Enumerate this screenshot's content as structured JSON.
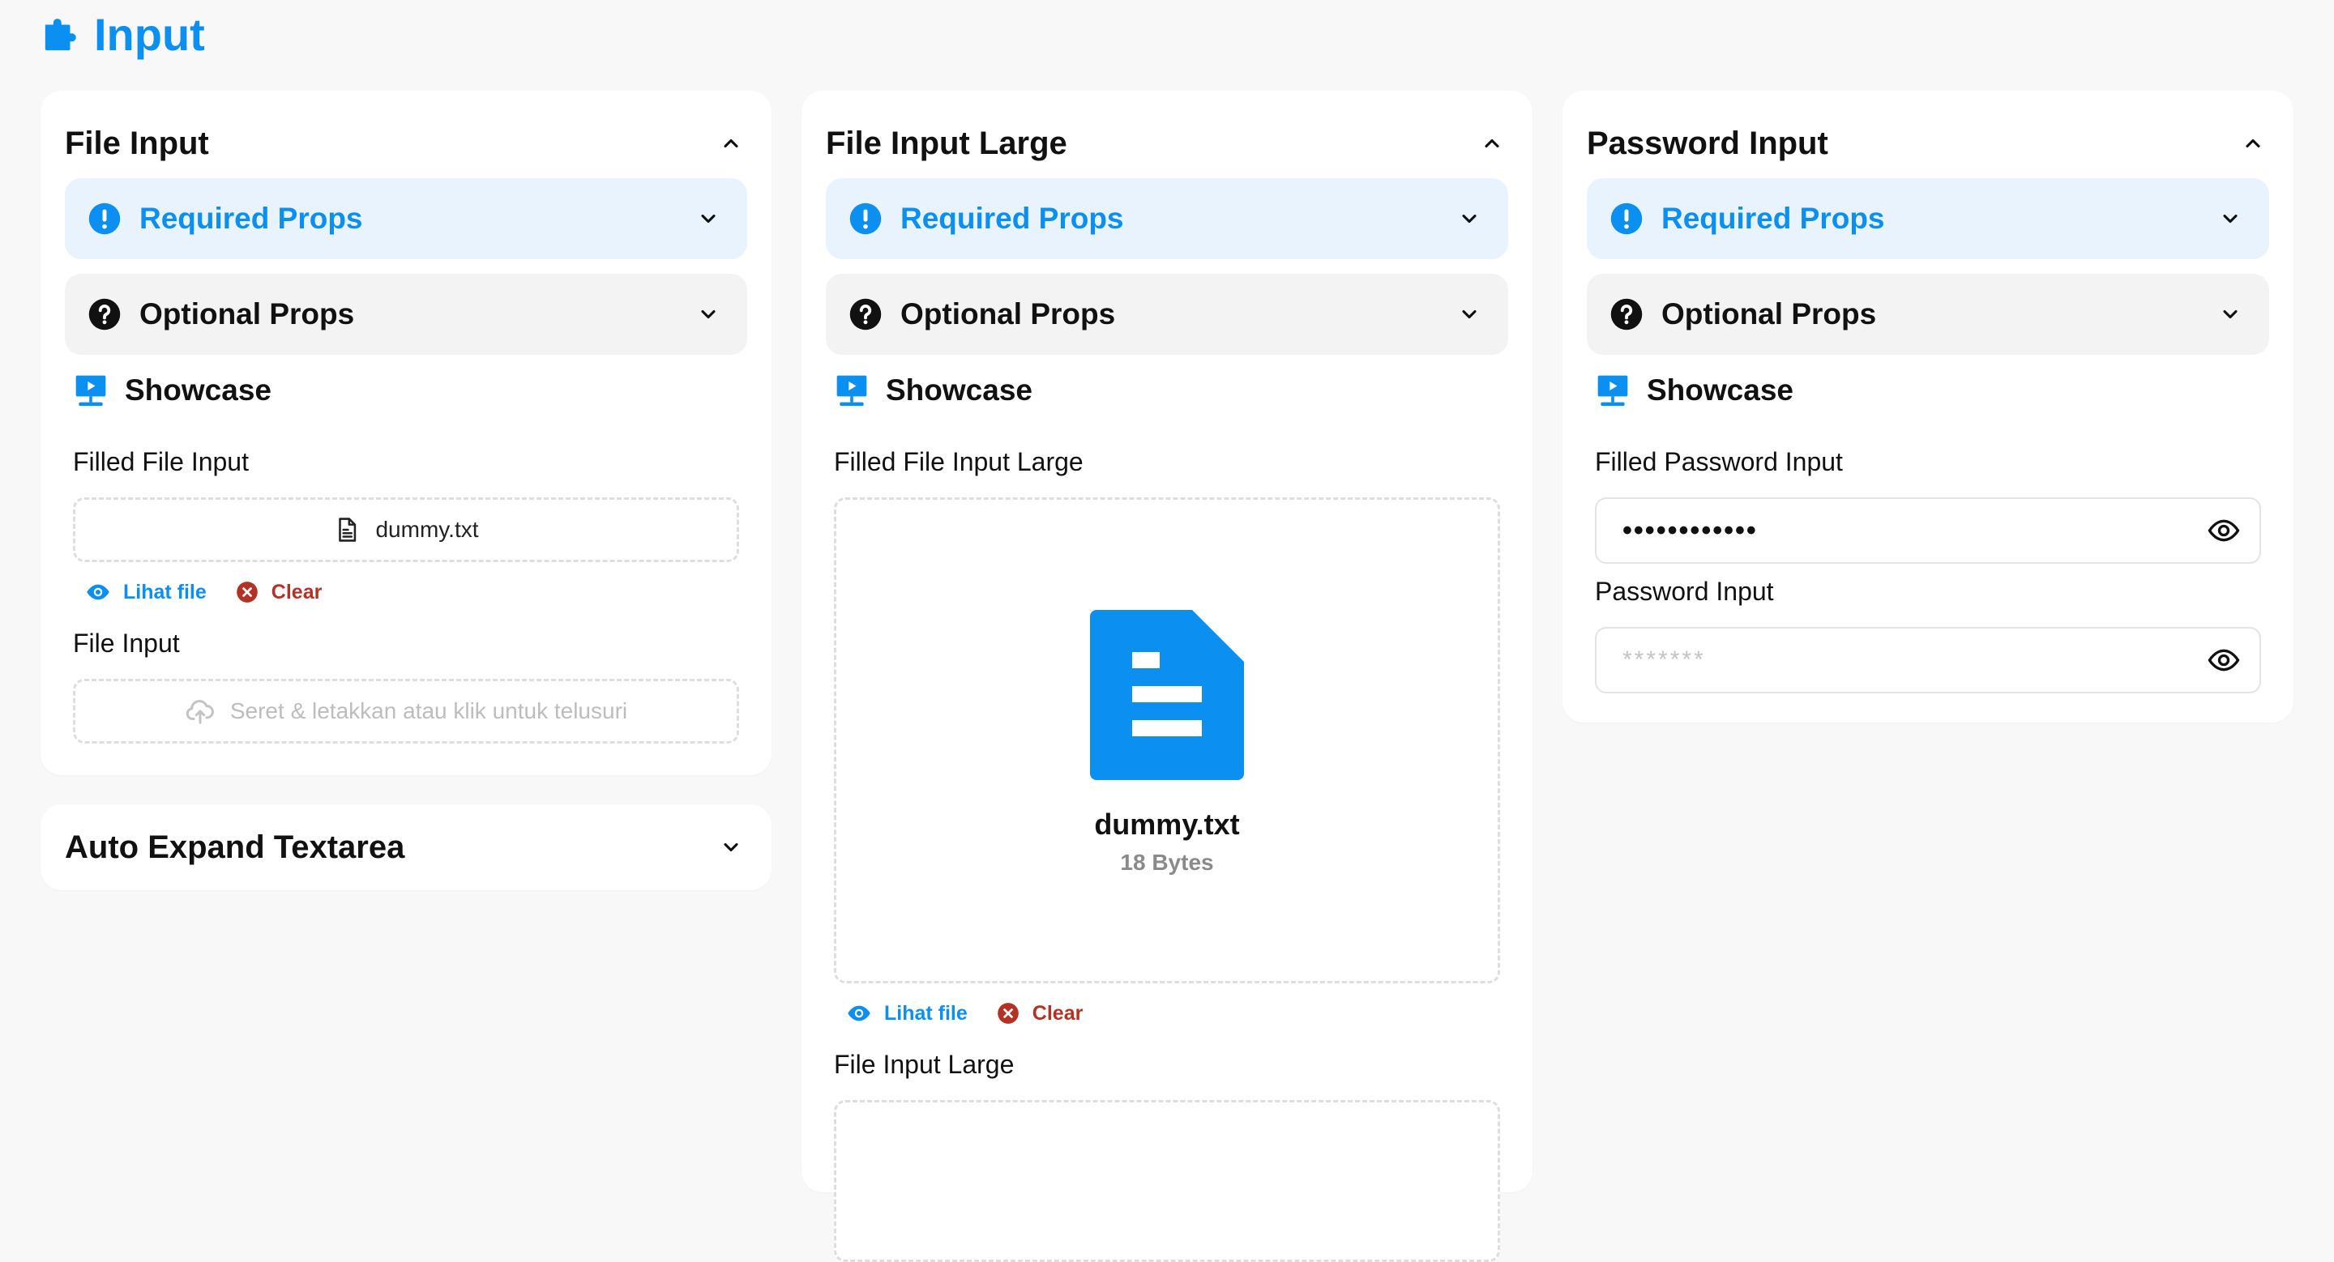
{
  "page": {
    "title": "Input"
  },
  "colors": {
    "accent": "#0b8ff0",
    "danger": "#b33225",
    "req_bg": "#e8f3fd",
    "opt_bg": "#f3f3f3"
  },
  "cards": {
    "file_input": {
      "title": "File Input",
      "required_label": "Required Props",
      "optional_label": "Optional Props",
      "showcase_label": "Showcase",
      "filled_label": "Filled File Input",
      "filled_filename": "dummy.txt",
      "view_label": "Lihat file",
      "clear_label": "Clear",
      "empty_label": "File Input",
      "empty_placeholder": "Seret & letakkan atau klik untuk telusuri"
    },
    "textarea": {
      "title": "Auto Expand Textarea"
    },
    "file_input_large": {
      "title": "File Input Large",
      "required_label": "Required Props",
      "optional_label": "Optional Props",
      "showcase_label": "Showcase",
      "filled_label": "Filled File Input Large",
      "filename": "dummy.txt",
      "filesize": "18 Bytes",
      "view_label": "Lihat file",
      "clear_label": "Clear",
      "empty_label": "File Input Large"
    },
    "password_input": {
      "title": "Password Input",
      "required_label": "Required Props",
      "optional_label": "Optional Props",
      "showcase_label": "Showcase",
      "filled_label": "Filled Password Input",
      "filled_value": "••••••••••••",
      "empty_label": "Password Input",
      "empty_placeholder": "*******"
    }
  },
  "icons": {
    "header": "puzzle-icon",
    "required": "exclamation-circle-icon",
    "optional": "question-circle-icon",
    "showcase": "presentation-icon",
    "file": "document-icon",
    "upload": "cloud-upload-icon",
    "view": "eye-icon",
    "clear": "x-circle-icon",
    "toggle_visibility": "eye-icon"
  }
}
